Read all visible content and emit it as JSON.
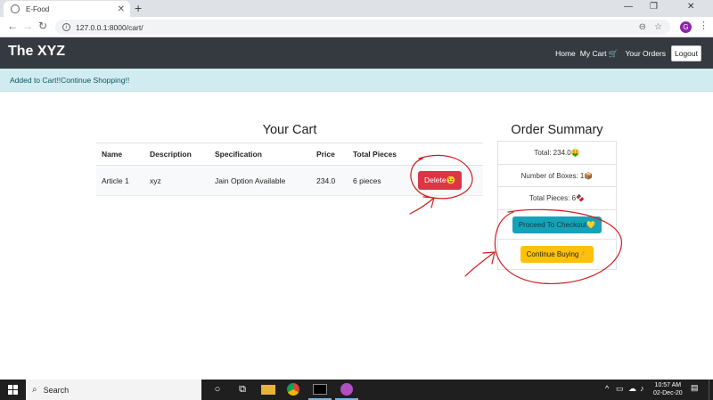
{
  "browser": {
    "tab_title": "E-Food",
    "url": "127.0.0.1:8000/cart/",
    "profile_initial": "G"
  },
  "site": {
    "brand": "The XYZ",
    "nav": {
      "home": "Home",
      "cart": "My Cart 🛒",
      "orders": "Your Orders",
      "logout": "Logout"
    },
    "alert": "Added to Cart!!Continue Shopping!!"
  },
  "cart": {
    "title": "Your Cart",
    "headers": [
      "Name",
      "Description",
      "Specification",
      "Price",
      "Total Pieces",
      ""
    ],
    "rows": [
      {
        "name": "Article 1",
        "description": "xyz",
        "specification": "Jain Option Available",
        "price": "234.0",
        "pieces": "6 pieces",
        "delete_label": "Delete😉"
      }
    ]
  },
  "summary": {
    "title": "Order Summary",
    "total": "Total: 234.0🤑",
    "boxes": "Number of Boxes: 1📦",
    "pieces": "Total Pieces: 6🍫",
    "checkout_label": "Proceed To Checkout💛",
    "continue_label": "Continue Buying👌"
  },
  "taskbar": {
    "search": "Search",
    "time": "10:57 AM",
    "date": "02-Dec-20"
  },
  "colors": {
    "navbar": "#343a40",
    "alert_bg": "#d1ecf1",
    "delete": "#dc3545",
    "checkout": "#17a2b8",
    "continue": "#ffc107",
    "annotation": "#d21c1c"
  }
}
